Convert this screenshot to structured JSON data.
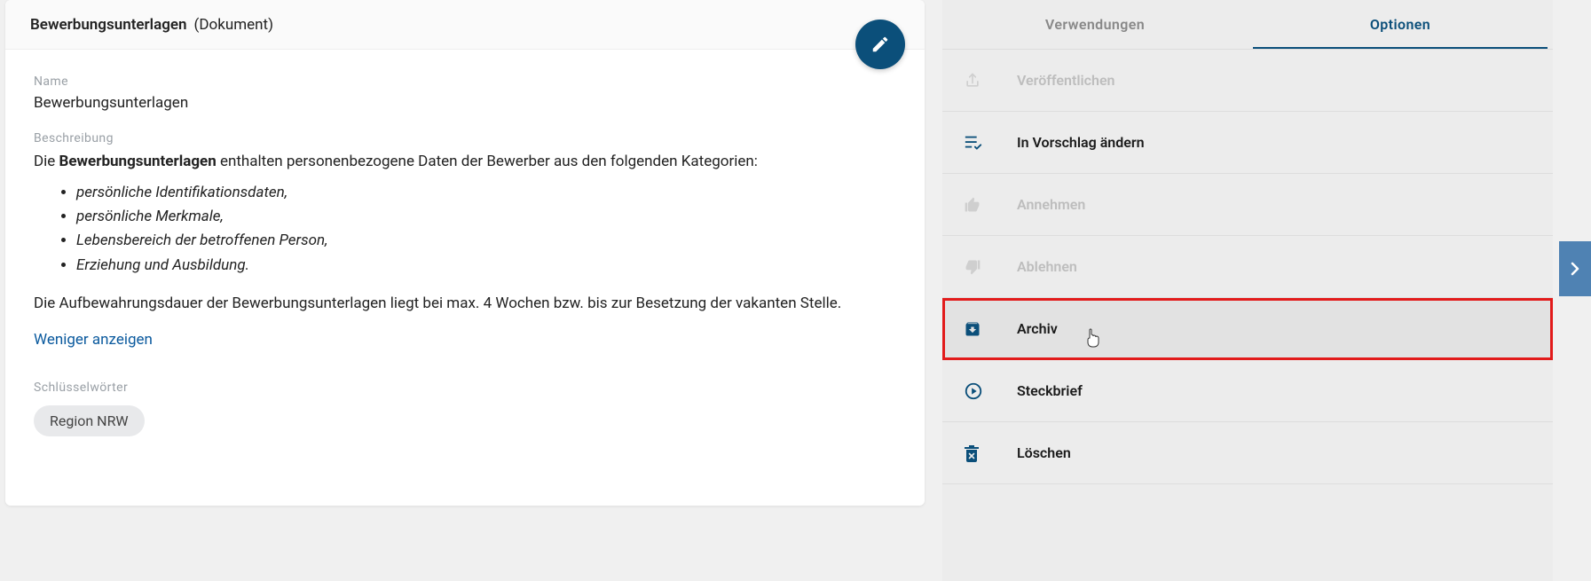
{
  "header": {
    "title": "Bewerbungsunterlagen",
    "doc_type": "(Dokument)"
  },
  "fields": {
    "name_label": "Name",
    "name_value": "Bewerbungsunterlagen",
    "description_label": "Beschreibung",
    "description_intro_prefix": "Die ",
    "description_intro_bold": "Bewerbungsunterlagen",
    "description_intro_suffix": " enthalten personenbezogene Daten der Bewerber aus den folgenden Kategorien:",
    "description_list": [
      "persönliche Identifikationsdaten,",
      "persönliche Merkmale,",
      "Lebensbereich der betroffenen Person,",
      "Erziehung und Ausbildung."
    ],
    "description_paragraph2": "Die Aufbewahrungsdauer der Bewerbungsunterlagen liegt bei max. 4 Wochen bzw. bis zur Besetzung der vakanten Stelle.",
    "show_less": "Weniger anzeigen",
    "keywords_label": "Schlüsselwörter",
    "keyword_tag": "Region NRW"
  },
  "tabs": {
    "usages": "Verwendungen",
    "options": "Optionen"
  },
  "options": [
    {
      "key": "publish",
      "label": "Veröffentlichen",
      "enabled": false,
      "icon": "share"
    },
    {
      "key": "propose",
      "label": "In Vorschlag ändern",
      "enabled": true,
      "icon": "list-check"
    },
    {
      "key": "accept",
      "label": "Annehmen",
      "enabled": false,
      "icon": "thumb-up"
    },
    {
      "key": "reject",
      "label": "Ablehnen",
      "enabled": false,
      "icon": "thumb-down"
    },
    {
      "key": "archive",
      "label": "Archiv",
      "enabled": true,
      "icon": "archive",
      "highlighted": true
    },
    {
      "key": "profile",
      "label": "Steckbrief",
      "enabled": true,
      "icon": "play-circle"
    },
    {
      "key": "delete",
      "label": "Löschen",
      "enabled": true,
      "icon": "trash"
    }
  ],
  "colors": {
    "primary": "#0b4f7a",
    "link": "#0b5a9e",
    "highlight_border": "#e21b1b",
    "collapse": "#4f82b3"
  }
}
